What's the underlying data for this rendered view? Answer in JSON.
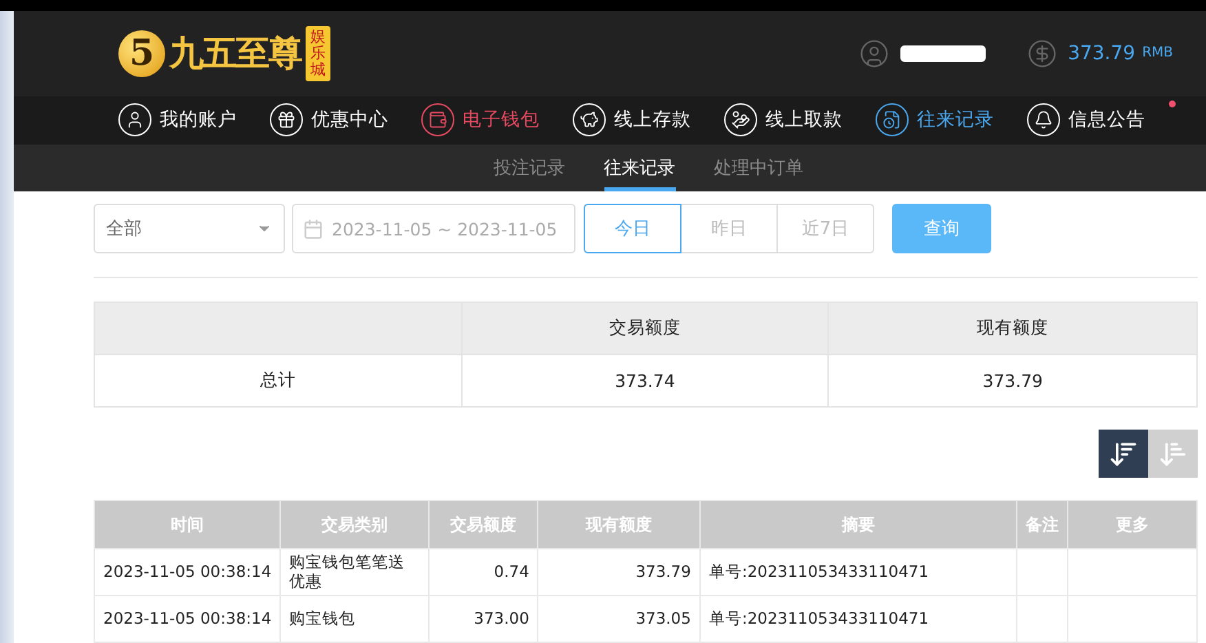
{
  "header": {
    "logo": {
      "mark": "5",
      "name": "九五至尊",
      "badge": "娱乐城"
    },
    "username_redacted": true,
    "balance": "373.79",
    "currency": "RMB"
  },
  "nav": [
    {
      "label": "我的账户",
      "color": "#ffffff",
      "dot": false
    },
    {
      "label": "优惠中心",
      "color": "#ffffff",
      "dot": false
    },
    {
      "label": "电子钱包",
      "color": "#e84a62",
      "dot": false
    },
    {
      "label": "线上存款",
      "color": "#ffffff",
      "dot": false
    },
    {
      "label": "线上取款",
      "color": "#ffffff",
      "dot": false
    },
    {
      "label": "往来记录",
      "color": "#4aa8f0",
      "dot": false
    },
    {
      "label": "信息公告",
      "color": "#ffffff",
      "dot": true
    }
  ],
  "subnav": [
    {
      "label": "投注记录",
      "selected": false
    },
    {
      "label": "往来记录",
      "selected": true
    },
    {
      "label": "处理中订单",
      "selected": false
    }
  ],
  "filters": {
    "type_select": "全部",
    "date_range": "2023-11-05 ~ 2023-11-05",
    "periods": [
      {
        "label": "今日",
        "selected": true
      },
      {
        "label": "昨日",
        "selected": false
      },
      {
        "label": "近7日",
        "selected": false
      }
    ],
    "query_button": "查询"
  },
  "summary": {
    "columns": [
      "",
      "交易额度",
      "现有额度"
    ],
    "rows": [
      [
        "总计",
        "373.74",
        "373.79"
      ]
    ]
  },
  "sort": [
    {
      "kind": "desc",
      "selected": true
    },
    {
      "kind": "asc",
      "selected": false
    }
  ],
  "table": {
    "columns": [
      "时间",
      "交易类别",
      "交易额度",
      "现有额度",
      "摘要",
      "备注",
      "更多"
    ],
    "rows": [
      [
        "2023-11-05 00:38:14",
        "购宝钱包笔笔送优惠",
        "0.74",
        "373.79",
        "单号:202311053433110471",
        "",
        ""
      ],
      [
        "2023-11-05 00:38:14",
        "购宝钱包",
        "373.00",
        "373.05",
        "单号:202311053433110471",
        "",
        ""
      ]
    ]
  }
}
